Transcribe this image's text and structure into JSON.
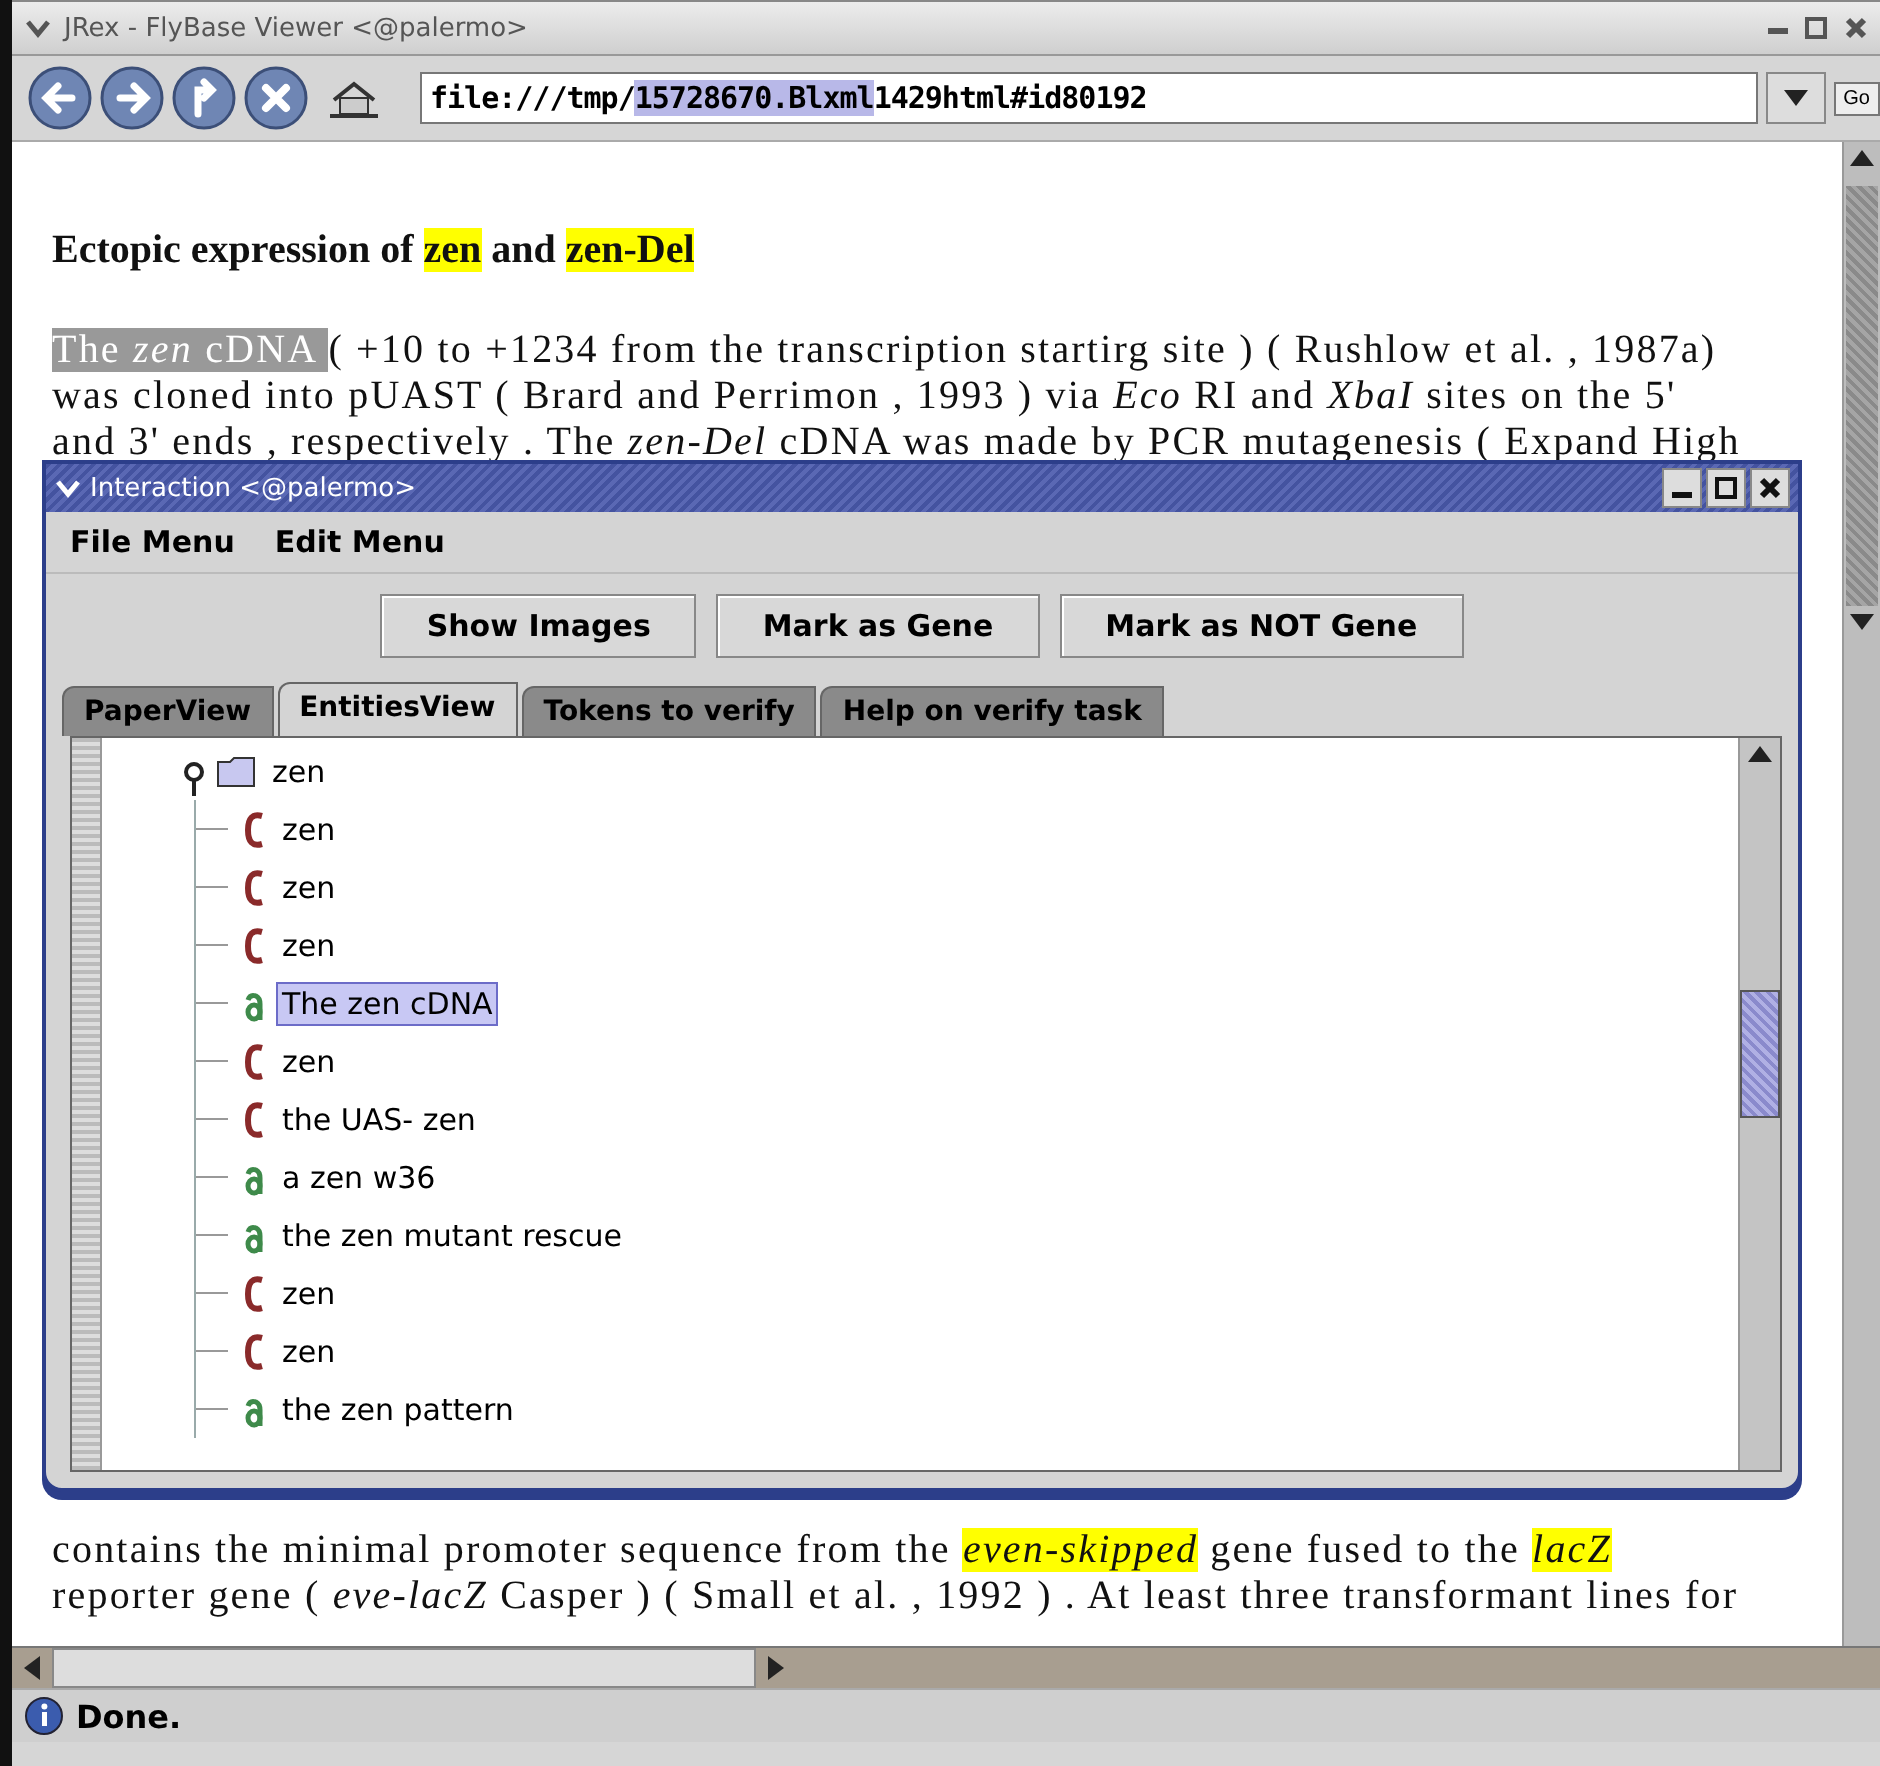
{
  "window": {
    "title": "JRex - FlyBase Viewer <@palermo>"
  },
  "toolbar": {
    "url_segments": [
      {
        "text": "file:///tmp/",
        "selected": false
      },
      {
        "text": "15728670.Blxml",
        "selected": true
      },
      {
        "text": "1429html#id80192",
        "selected": false
      }
    ],
    "go_button": "Go"
  },
  "content": {
    "heading": [
      {
        "text": "Ectopic expression of ",
        "kind": "plain"
      },
      {
        "text": "zen",
        "kind": "highlight"
      },
      {
        "text": " and ",
        "kind": "plain"
      },
      {
        "text": "zen-Del",
        "kind": "highlight"
      }
    ],
    "top_lines": [
      [
        {
          "text": "The *zen* cDNA ",
          "kind": "selection"
        },
        {
          "text": " ( +10 to +1234 from the transcription startirg site ) ( Rushlow et al. , 1987a)",
          "kind": "plain"
        }
      ],
      [
        {
          "text": "was cloned into pUAST ( Brard and Perrimon , 1993 ) via *Eco* RI and *XbaI* sites on the 5'",
          "kind": "plain"
        }
      ],
      [
        {
          "text": "and 3' ends , respectively . The *zen-Del* cDNA was made by PCR mutagenesis ( Expand High",
          "kind": "plain"
        }
      ]
    ],
    "bottom_lines": [
      [
        {
          "text": "contains the minimal promoter sequence from the ",
          "kind": "plain"
        },
        {
          "text": "*even-skipped*",
          "kind": "highlight"
        },
        {
          "text": " gene fused to the ",
          "kind": "plain"
        },
        {
          "text": "*lacZ*",
          "kind": "highlight"
        }
      ],
      [
        {
          "text": "reporter gene ( *eve-lacZ* Casper ) ( Small et al. , 1992 ) . At least three transformant lines for",
          "kind": "plain"
        }
      ]
    ]
  },
  "dialog": {
    "title": "Interaction <@palermo>",
    "menus": [
      "File Menu",
      "Edit Menu"
    ],
    "buttons": [
      "Show Images",
      "Mark as Gene",
      "Mark as NOT Gene"
    ],
    "tabs": [
      {
        "label": "PaperView",
        "selected": false
      },
      {
        "label": "EntitiesView",
        "selected": true
      },
      {
        "label": "Tokens to verify",
        "selected": false
      },
      {
        "label": "Help on verify task",
        "selected": false
      }
    ],
    "tree": {
      "label": "zen",
      "expanded": true,
      "children": [
        {
          "label": "zen",
          "kind": "class",
          "selected": false
        },
        {
          "label": "zen",
          "kind": "class",
          "selected": false
        },
        {
          "label": "zen",
          "kind": "class",
          "selected": false
        },
        {
          "label": "The zen cDNA",
          "kind": "annotation",
          "selected": true
        },
        {
          "label": "zen",
          "kind": "class",
          "selected": false
        },
        {
          "label": "the UAS- zen",
          "kind": "class",
          "selected": false
        },
        {
          "label": "a zen w36",
          "kind": "annotation",
          "selected": false
        },
        {
          "label": "the zen mutant  rescue",
          "kind": "annotation",
          "selected": false
        },
        {
          "label": "zen",
          "kind": "class",
          "selected": false
        },
        {
          "label": "zen",
          "kind": "class",
          "selected": false
        },
        {
          "label": "the zen pattern",
          "kind": "annotation",
          "selected": false
        }
      ]
    }
  },
  "status_bar": {
    "text": "Done."
  }
}
